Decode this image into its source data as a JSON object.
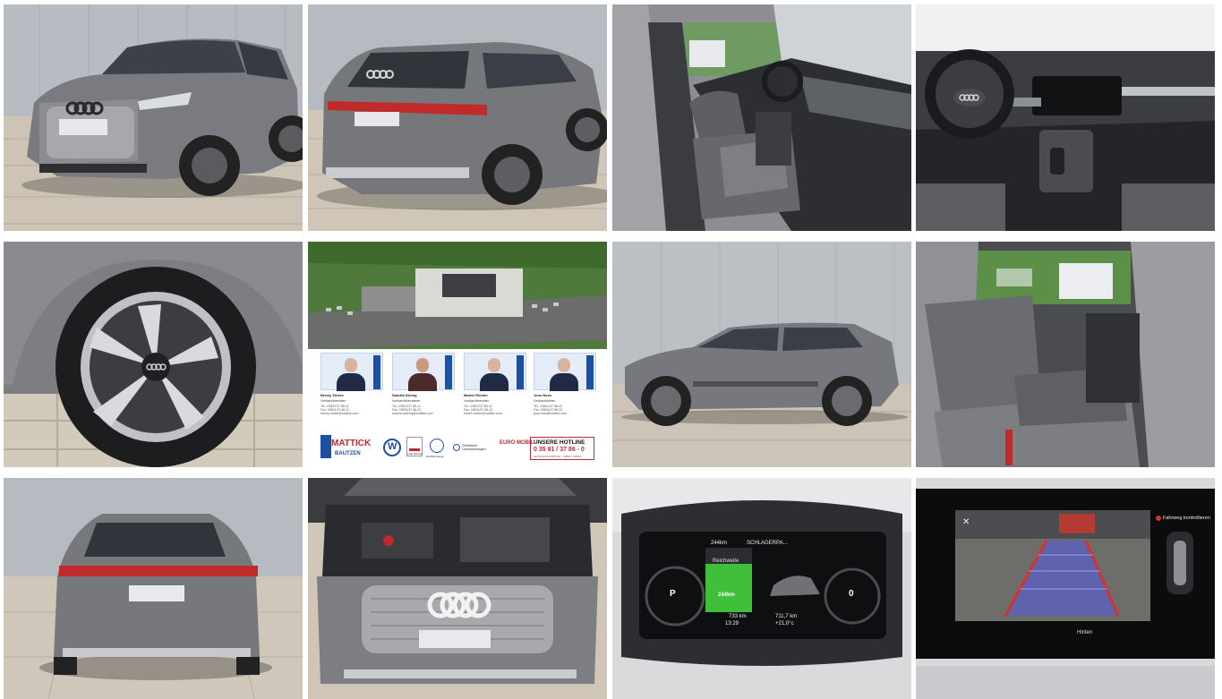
{
  "gallery": {
    "tiles": [
      {
        "name": "photo-front-three-quarter"
      },
      {
        "name": "photo-rear-three-quarter"
      },
      {
        "name": "photo-front-seats-interior"
      },
      {
        "name": "photo-dashboard-cockpit"
      },
      {
        "name": "photo-wheel-rim"
      },
      {
        "name": "photo-dealership-info-card"
      },
      {
        "name": "photo-side-profile"
      },
      {
        "name": "photo-rear-seats-interior"
      },
      {
        "name": "photo-rear-view"
      },
      {
        "name": "photo-engine-bay"
      },
      {
        "name": "photo-virtual-cockpit-display"
      },
      {
        "name": "photo-rear-camera-display"
      }
    ]
  },
  "dealer_card": {
    "staff": [
      {
        "name": "Benny Zieske",
        "role": "Verkaufsberater",
        "contact": "Tel.: 03591/37 86-11\nFax: 03591/37 86-22\nbenny.zieske@mattick.com"
      },
      {
        "name": "Sandra Döring",
        "role": "Verkaufsberaterin",
        "contact": "Tel.: 03591/37 86-11\nFax: 03591/37 86-22\nsandra.doering@mattick.com"
      },
      {
        "name": "Martin Richter",
        "role": "Verkaufsberater",
        "contact": "Tel.: 03591/37 86-11\nFax: 03591/37 86-22\nmartin.richter@mattick.com"
      },
      {
        "name": "Jens Noss",
        "role": "Verkaufsleiter",
        "contact": "Tel.: 03591/37 86-10\nFax: 03591/37 86-22\njens.noss@mattick.com"
      }
    ],
    "logo_text": "MATTICK",
    "logo_subtext": "BAUTZEN",
    "audi_service_text": "Audi Service",
    "vw_nutzfahrzeuge_text": "Nutzfahrzeuge",
    "zertifiziert_text": "Zertifizierte Gebrauchtwagen",
    "euro_mobil_text": "EURO MOBIL",
    "hotline_title": "UNSERE HOTLINE",
    "hotline_number": "0 35 91 / 37 86 - 0",
    "hotline_sub": "AUTOHAUS MATTICK · 03591 / 3786-0"
  },
  "cockpit_display": {
    "header_range": "244km",
    "header_station": "SCHLAGERPA...",
    "tab_label": "Reichweite",
    "battery_value": "244km",
    "gear": "P",
    "odo": "733 km",
    "time": "13:29",
    "trip": "711,7 km",
    "temp": "+21,0°c",
    "right_gauge_value": "0"
  },
  "camera_display": {
    "warning_label": "Fahrweg kontrollieren",
    "bottom_label": "Hinten",
    "close_symbol": "✕"
  },
  "colors": {
    "car_body": "#77787c",
    "pavement": "#cfc7ba",
    "wall": "#b9bcc1",
    "interior_dark": "#2d2f33",
    "seat": "#6d6f73",
    "audi_blue": "#1d4fa5",
    "camera_red": "#d8312a",
    "display_green": "#3fbf3a"
  }
}
